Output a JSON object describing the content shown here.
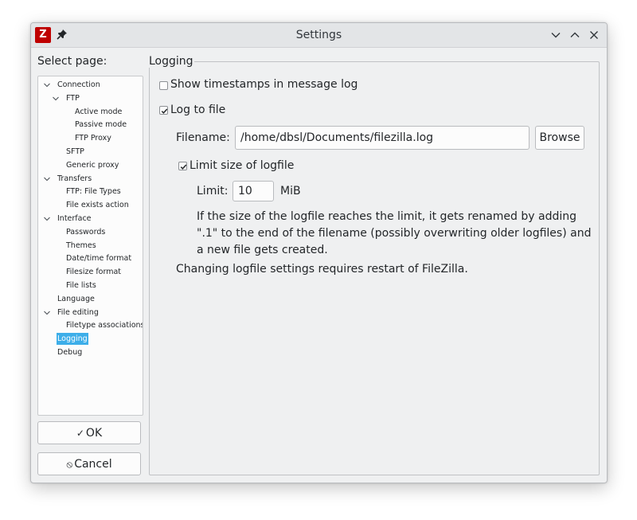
{
  "window": {
    "title": "Settings",
    "app_icon_label": "Z",
    "icons": [
      "filezilla-icon",
      "pin-icon",
      "chevron-down-icon",
      "chevron-up-icon",
      "close-icon"
    ]
  },
  "sidebar": {
    "label": "Select page:",
    "items": [
      {
        "label": "Connection",
        "level": 0,
        "expanded": true
      },
      {
        "label": "FTP",
        "level": 1,
        "expanded": true
      },
      {
        "label": "Active mode",
        "level": 2
      },
      {
        "label": "Passive mode",
        "level": 2
      },
      {
        "label": "FTP Proxy",
        "level": 2
      },
      {
        "label": "SFTP",
        "level": 1
      },
      {
        "label": "Generic proxy",
        "level": 1
      },
      {
        "label": "Transfers",
        "level": 0,
        "expanded": true
      },
      {
        "label": "FTP: File Types",
        "level": 1
      },
      {
        "label": "File exists action",
        "level": 1
      },
      {
        "label": "Interface",
        "level": 0,
        "expanded": true
      },
      {
        "label": "Passwords",
        "level": 1
      },
      {
        "label": "Themes",
        "level": 1
      },
      {
        "label": "Date/time format",
        "level": 1
      },
      {
        "label": "Filesize format",
        "level": 1
      },
      {
        "label": "File lists",
        "level": 1
      },
      {
        "label": "Language",
        "level": 0
      },
      {
        "label": "File editing",
        "level": 0,
        "expanded": true
      },
      {
        "label": "Filetype associations",
        "level": 1
      },
      {
        "label": "Logging",
        "level": 0,
        "selected": true
      },
      {
        "label": "Debug",
        "level": 0
      }
    ]
  },
  "buttons": {
    "ok_label": "OK",
    "cancel_label": "Cancel"
  },
  "logging": {
    "group_title": "Logging",
    "show_timestamps": {
      "label": "Show timestamps in message log",
      "checked": false
    },
    "log_to_file": {
      "label": "Log to file",
      "checked": true
    },
    "filename_label": "Filename:",
    "filename_value": "/home/dbsl/Documents/filezilla.log",
    "browse_label": "Browse",
    "limit_size": {
      "label": "Limit size of logfile",
      "checked": true
    },
    "limit_label": "Limit:",
    "limit_value": "10",
    "limit_unit": "MiB",
    "limit_info": "If the size of the logfile reaches the limit, it gets renamed by adding \".1\" to the end of the filename (possibly overwriting older logfiles) and a new file gets created.",
    "restart_note": "Changing logfile settings requires restart of FileZilla."
  }
}
